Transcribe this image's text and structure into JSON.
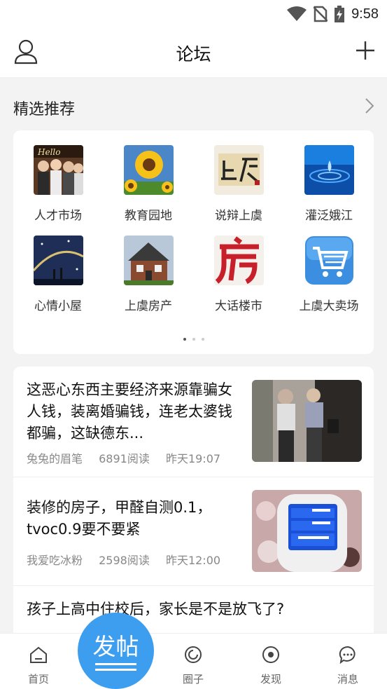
{
  "status_bar": {
    "time": "9:58",
    "icons": [
      "wifi-icon",
      "no-sim-icon",
      "battery-charging-icon"
    ]
  },
  "header": {
    "title": "论坛",
    "left_icon": "user-icon",
    "right_icon": "plus-icon"
  },
  "featured": {
    "title": "精选推荐",
    "more_icon": "chevron-right-icon",
    "items": [
      {
        "label": "人才市场",
        "icon": "people-photo"
      },
      {
        "label": "教育园地",
        "icon": "sunflower-photo"
      },
      {
        "label": "说辩上虞",
        "icon": "calligraphy-photo"
      },
      {
        "label": "灌泛娥江",
        "icon": "water-drop-photo"
      },
      {
        "label": "心情小屋",
        "icon": "night-sky-photo"
      },
      {
        "label": "上虞房产",
        "icon": "house-photo"
      },
      {
        "label": "大话楼市",
        "icon": "fang-character-photo"
      },
      {
        "label": "上虞大卖场",
        "icon": "shopping-cart-icon"
      }
    ],
    "page_count": 3,
    "active_page": 1
  },
  "posts": [
    {
      "title": "这恶心东西主要经济来源靠骗女人钱，装离婚骗钱，连老太婆钱都骗，这缺德东...",
      "author": "兔兔的眉笔",
      "reads": "6891阅读",
      "time": "昨天19:07",
      "thumb": "people-street-photo"
    },
    {
      "title": "装修的房子，甲醛自测0.1，tvoc0.9要不要紧",
      "author": "我爱吃冰粉",
      "reads": "2598阅读",
      "time": "昨天12:00",
      "thumb": "formaldehyde-meter-photo"
    },
    {
      "title": "孩子上高中住校后，家长是不是放飞了?",
      "author": "",
      "reads": "",
      "time": ""
    }
  ],
  "tabbar": {
    "tabs": [
      {
        "label": "首页",
        "icon": "home-icon"
      },
      {
        "label": "圈子",
        "icon": "circle-icon"
      },
      {
        "label": "发现",
        "icon": "compass-icon"
      },
      {
        "label": "消息",
        "icon": "chat-bubble-icon"
      }
    ],
    "post_button": "发帖"
  },
  "colors": {
    "accent": "#3d9ef0",
    "background": "#f3f3f3"
  }
}
